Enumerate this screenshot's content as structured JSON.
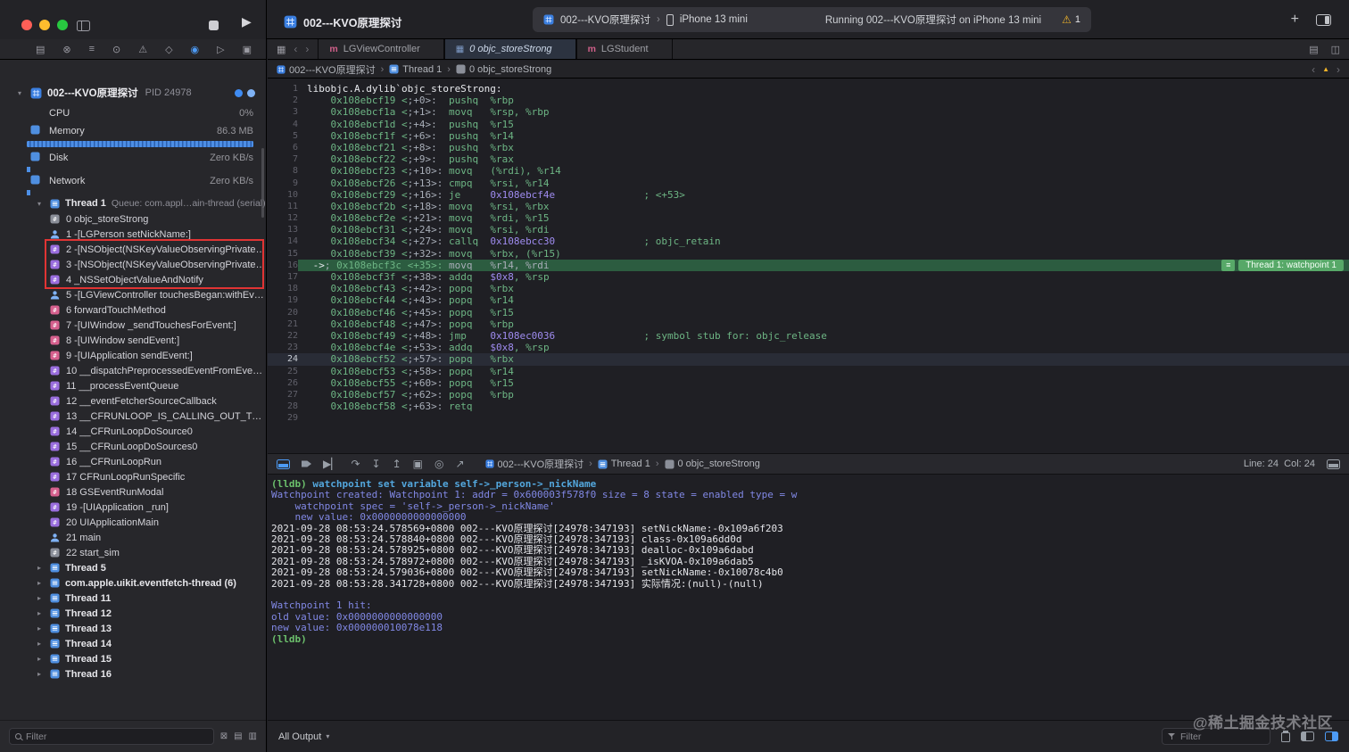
{
  "titlebar": {
    "project_title": "002---KVO原理探讨",
    "scheme": "002---KVO原理探讨",
    "device": "iPhone 13 mini",
    "status": "Running 002---KVO原理探讨 on iPhone 13 mini",
    "warning_count": "1"
  },
  "navigator": {
    "tabs": [
      "project",
      "source-control",
      "symbols",
      "find",
      "issues",
      "tests",
      "debug",
      "breakpoints",
      "reports"
    ],
    "selected_tab": "debug",
    "process": {
      "name": "002---KVO原理探讨",
      "pid_label": "PID 24978"
    },
    "gauges": [
      {
        "id": "cpu",
        "label": "CPU",
        "value": "0%",
        "icon": false,
        "bar": "none"
      },
      {
        "id": "memory",
        "label": "Memory",
        "value": "86.3 MB",
        "icon": true,
        "bar": "full"
      },
      {
        "id": "disk",
        "label": "Disk",
        "value": "Zero KB/s",
        "icon": true,
        "bar": "tick"
      },
      {
        "id": "network",
        "label": "Network",
        "value": "Zero KB/s",
        "icon": true,
        "bar": "tick"
      }
    ],
    "thread1": {
      "name": "Thread 1",
      "queue": "Queue: com.appl…ain-thread (serial)",
      "frames": [
        {
          "n": "0",
          "label": "objc_storeStrong",
          "icon": "gray"
        },
        {
          "n": "1",
          "label": "-[LGPerson setNickName:]",
          "icon": "person"
        },
        {
          "n": "2",
          "label": "-[NSObject(NSKeyValueObservingPrivate…",
          "icon": "purple"
        },
        {
          "n": "3",
          "label": "-[NSObject(NSKeyValueObservingPrivate…",
          "icon": "purple"
        },
        {
          "n": "4",
          "label": "_NSSetObjectValueAndNotify",
          "icon": "purple"
        },
        {
          "n": "5",
          "label": "-[LGViewController touchesBegan:withEv…",
          "icon": "person"
        },
        {
          "n": "6",
          "label": "forwardTouchMethod",
          "icon": "pink"
        },
        {
          "n": "7",
          "label": "-[UIWindow _sendTouchesForEvent:]",
          "icon": "pink"
        },
        {
          "n": "8",
          "label": "-[UIWindow sendEvent:]",
          "icon": "pink"
        },
        {
          "n": "9",
          "label": "-[UIApplication sendEvent:]",
          "icon": "pink"
        },
        {
          "n": "10",
          "label": "__dispatchPreprocessedEventFromEven…",
          "icon": "purple"
        },
        {
          "n": "11",
          "label": "__processEventQueue",
          "icon": "purple"
        },
        {
          "n": "12",
          "label": "__eventFetcherSourceCallback",
          "icon": "purple"
        },
        {
          "n": "13",
          "label": "__CFRUNLOOP_IS_CALLING_OUT_TO_…",
          "icon": "purple"
        },
        {
          "n": "14",
          "label": "__CFRunLoopDoSource0",
          "icon": "purple"
        },
        {
          "n": "15",
          "label": "__CFRunLoopDoSources0",
          "icon": "purple"
        },
        {
          "n": "16",
          "label": "__CFRunLoopRun",
          "icon": "purple"
        },
        {
          "n": "17",
          "label": "CFRunLoopRunSpecific",
          "icon": "purple"
        },
        {
          "n": "18",
          "label": "GSEventRunModal",
          "icon": "pink"
        },
        {
          "n": "19",
          "label": "-[UIApplication _run]",
          "icon": "purple"
        },
        {
          "n": "20",
          "label": "UIApplicationMain",
          "icon": "purple"
        },
        {
          "n": "21",
          "label": "main",
          "icon": "person"
        },
        {
          "n": "22",
          "label": "start_sim",
          "icon": "gray"
        }
      ]
    },
    "other_threads": [
      "Thread 5",
      "com.apple.uikit.eventfetch-thread (6)",
      "Thread 11",
      "Thread 12",
      "Thread 13",
      "Thread 14",
      "Thread 15",
      "Thread 16"
    ],
    "filter_placeholder": "Filter"
  },
  "tabs": [
    {
      "label": "LGViewController",
      "icon": "objc",
      "active": false
    },
    {
      "label": "0 objc_storeStrong",
      "icon": "asm",
      "active": true
    },
    {
      "label": "LGStudent",
      "icon": "objc",
      "active": false
    }
  ],
  "jumpbar": {
    "items": [
      {
        "label": "002---KVO原理探讨",
        "icon": "app"
      },
      {
        "label": "Thread 1",
        "icon": "thread"
      },
      {
        "label": "0 objc_storeStrong",
        "icon": "frame"
      }
    ]
  },
  "editor": {
    "current_line": 24,
    "watchpoint_line": 16,
    "watchpoint_badge": "Thread 1: watchpoint 1",
    "lines": [
      "libobjc.A.dylib`objc_storeStrong:",
      "    0x108ebcf19 <+0>:  pushq  %rbp",
      "    0x108ebcf1a <+1>:  movq   %rsp, %rbp",
      "    0x108ebcf1d <+4>:  pushq  %r15",
      "    0x108ebcf1f <+6>:  pushq  %r14",
      "    0x108ebcf21 <+8>:  pushq  %rbx",
      "    0x108ebcf22 <+9>:  pushq  %rax",
      "    0x108ebcf23 <+10>: movq   (%rdi), %r14",
      "    0x108ebcf26 <+13>: cmpq   %rsi, %r14",
      "    0x108ebcf29 <+16>: je     0x108ebcf4e               ; <+53>",
      "    0x108ebcf2b <+18>: movq   %rsi, %rbx",
      "    0x108ebcf2e <+21>: movq   %rdi, %r15",
      "    0x108ebcf31 <+24>: movq   %rsi, %rdi",
      "    0x108ebcf34 <+27>: callq  0x108ebcc30               ; objc_retain",
      "    0x108ebcf39 <+32>: movq   %rbx, (%r15)",
      " -> 0x108ebcf3c <+35>: movq   %r14, %rdi",
      "    0x108ebcf3f <+38>: addq   $0x8, %rsp",
      "    0x108ebcf43 <+42>: popq   %rbx",
      "    0x108ebcf44 <+43>: popq   %r14",
      "    0x108ebcf46 <+45>: popq   %r15",
      "    0x108ebcf48 <+47>: popq   %rbp",
      "    0x108ebcf49 <+48>: jmp    0x108ec0036               ; symbol stub for: objc_release",
      "    0x108ebcf4e <+53>: addq   $0x8, %rsp",
      "    0x108ebcf52 <+57>: popq   %rbx",
      "    0x108ebcf53 <+58>: popq   %r14",
      "    0x108ebcf55 <+60>: popq   %r15",
      "    0x108ebcf57 <+62>: popq   %rbp",
      "    0x108ebcf58 <+63>: retq",
      ""
    ]
  },
  "debugbar": {
    "breadcrumb": [
      {
        "label": "002---KVO原理探讨",
        "icon": "app"
      },
      {
        "label": "Thread 1",
        "icon": "thread"
      },
      {
        "label": "0 objc_storeStrong",
        "icon": "frame"
      }
    ],
    "line_col": "Line: 24  Col: 24"
  },
  "console": {
    "all_output_label": "All Output",
    "filter_placeholder": "Filter",
    "lines": [
      {
        "prompt": "(lldb) ",
        "text": "watchpoint set variable self->_person->_nickName",
        "cls": "cmd"
      },
      {
        "text": "Watchpoint created: Watchpoint 1: addr = 0x600003f578f0 size = 8 state = enabled type = w",
        "cls": "lldb"
      },
      {
        "text": "    watchpoint spec = 'self->_person->_nickName'",
        "cls": "lldb"
      },
      {
        "text": "    new value: 0x0000000000000000",
        "cls": "lldb"
      },
      {
        "text": "2021-09-28 08:53:24.578569+0800 002---KVO原理探讨[24978:347193] setNickName:-0x109a6f203",
        "cls": "log"
      },
      {
        "text": "2021-09-28 08:53:24.578840+0800 002---KVO原理探讨[24978:347193] class-0x109a6dd0d",
        "cls": "log"
      },
      {
        "text": "2021-09-28 08:53:24.578925+0800 002---KVO原理探讨[24978:347193] dealloc-0x109a6dabd",
        "cls": "log"
      },
      {
        "text": "2021-09-28 08:53:24.578972+0800 002---KVO原理探讨[24978:347193] _isKVOA-0x109a6dab5",
        "cls": "log"
      },
      {
        "text": "2021-09-28 08:53:24.579036+0800 002---KVO原理探讨[24978:347193] setNickName:-0x10078c4b0",
        "cls": "log"
      },
      {
        "text": "2021-09-28 08:53:28.341728+0800 002---KVO原理探讨[24978:347193] 实际情况:(null)-(null)",
        "cls": "log"
      },
      {
        "text": "",
        "cls": "log"
      },
      {
        "text": "Watchpoint 1 hit:",
        "cls": "lldb"
      },
      {
        "text": "old value: 0x0000000000000000",
        "cls": "lldb"
      },
      {
        "text": "new value: 0x000000010078e118",
        "cls": "lldb"
      },
      {
        "prompt": "(lldb)",
        "text": "",
        "cls": "cmd"
      }
    ]
  },
  "watermark": "@稀土掘金技术社区",
  "colors": {
    "accent_blue": "#4d9bf5",
    "watchpoint_green": "#57a868",
    "warning_yellow": "#f0b429",
    "annotation_red": "#e03434",
    "address_green": "#6db584",
    "immediate_purple": "#9f8cf0",
    "lldb_violet": "#8188e5",
    "command_blue": "#53a7dd",
    "prompt_green": "#6cc06c"
  }
}
